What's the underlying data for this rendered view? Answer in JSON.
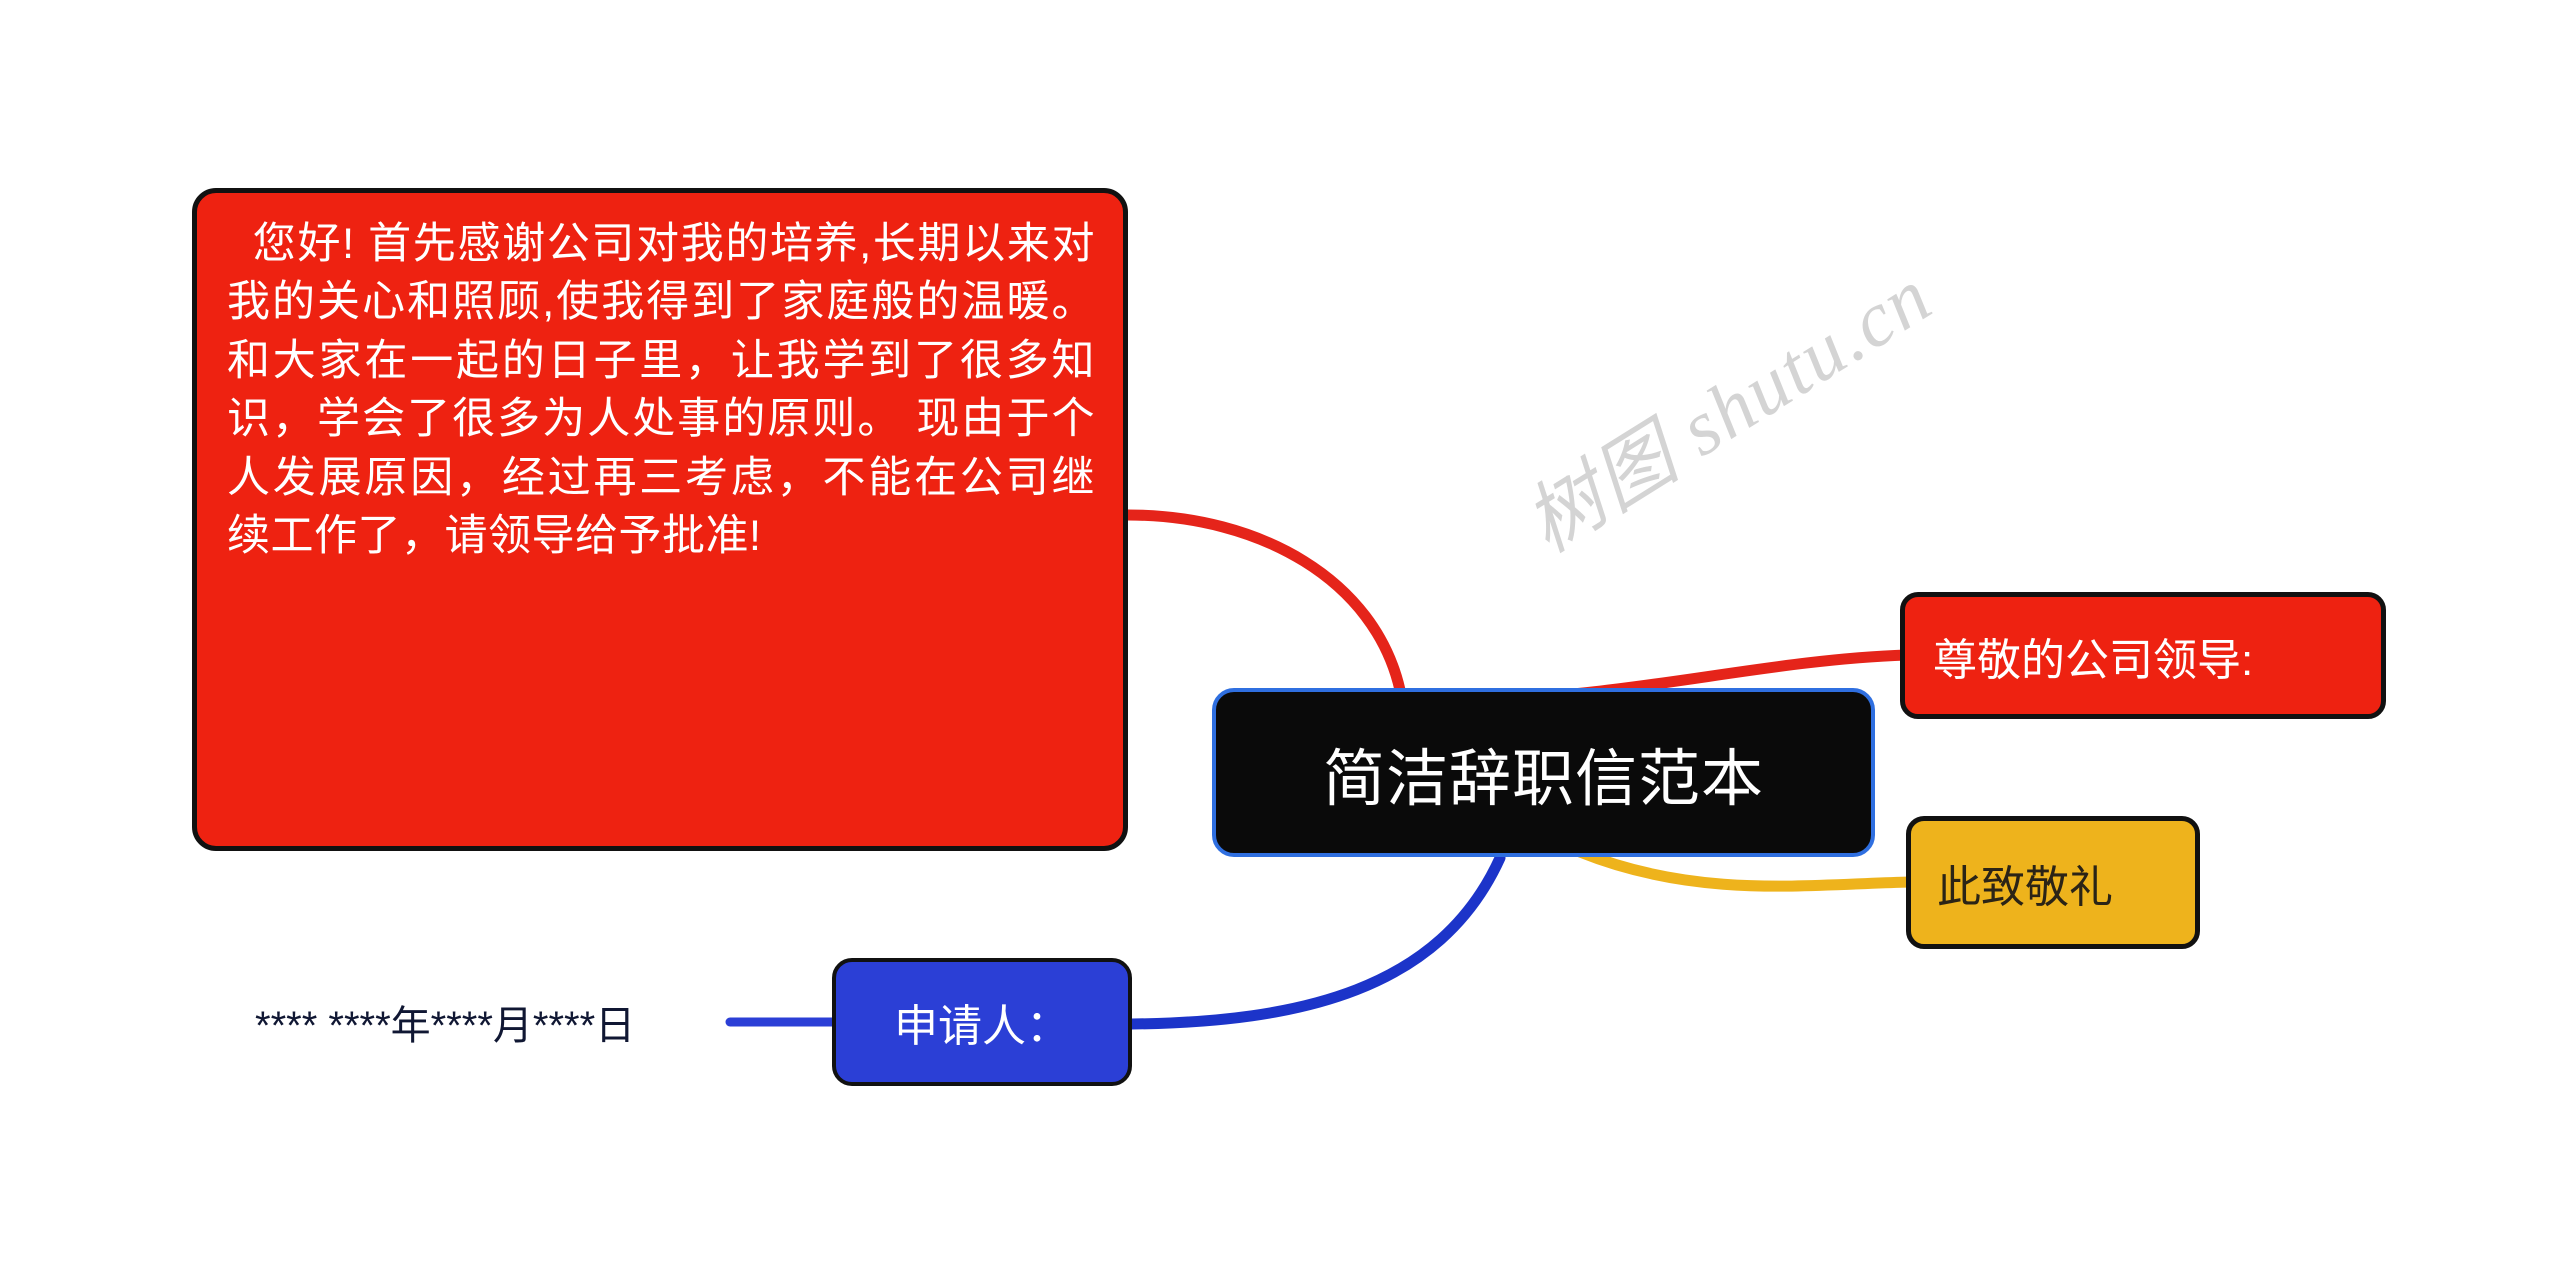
{
  "document": {
    "type": "mind-map",
    "background_color": "#ffffff"
  },
  "watermark": {
    "text": "树图 shutu.cn",
    "color": "#d4d4d4"
  },
  "center": {
    "label": "简洁辞职信范本",
    "fill_color": "#0a0a0a",
    "border_color": "#2f6fe0",
    "text_color": "#ffffff"
  },
  "nodes": {
    "essay": {
      "label": " 您好! 首先感谢公司对我的培养,长期以来对我的关心和照顾,使我得到了家庭般的温暖。和大家在一起的日子里，让我学到了很多知识，学会了很多为人处事的原则。 现由于个人发展原因，经过再三考虑，不能在公司继续工作了，请领导给予批准!",
      "fill_color": "#ee2211",
      "border_color": "#111111",
      "text_color": "#ffffff"
    },
    "salutation": {
      "label": "尊敬的公司领导:",
      "fill_color": "#ee2211",
      "border_color": "#111111",
      "text_color": "#ffffff"
    },
    "closing": {
      "label": "此致敬礼",
      "fill_color": "#eeb31c",
      "border_color": "#111111",
      "text_color": "#2b2416"
    },
    "applicant": {
      "label": "申请人：",
      "fill_color": "#2b3fd6",
      "border_color": "#111111",
      "text_color": "#ffffff"
    },
    "date": {
      "label": "**** ****年****月****日",
      "fill_color": "transparent",
      "text_color": "#101733"
    }
  },
  "connectors": {
    "essay_to_center_color": "#e5241a",
    "center_to_salutation_color": "#e5241a",
    "center_to_closing_color": "#eeb31c",
    "center_to_applicant_color": "#1c34c9",
    "applicant_to_date_color": "#2b3fd6"
  }
}
